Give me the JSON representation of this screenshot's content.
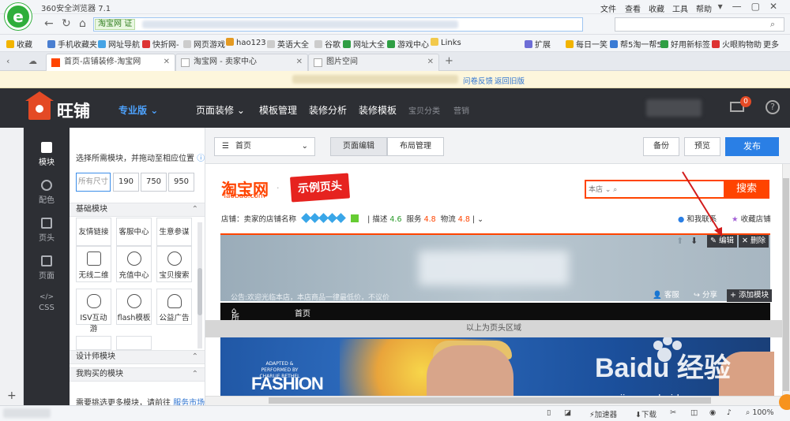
{
  "browser": {
    "title": "360安全浏览器 7.1",
    "menu": [
      "文件",
      "查看",
      "收藏",
      "工具",
      "帮助"
    ],
    "address_cert": "证",
    "bookmarks": [
      "收藏",
      "手机收藏夹",
      "网址导航",
      "快折网-",
      "网页游戏",
      "hao123",
      "英语大全",
      "谷歌",
      "网址大全",
      "游戏中心",
      "Links",
      "扩展",
      "每日一笑",
      "帮5淘一帮5",
      "好用新标签",
      "火眼购物助",
      "更多"
    ],
    "tabs": [
      {
        "label": "首页-店铺装修-淘宝网",
        "active": true
      },
      {
        "label": "淘宝网 - 卖家中心",
        "active": false
      },
      {
        "label": "图片空间",
        "active": false
      }
    ],
    "infobar": {
      "survey": "问卷反馈",
      "old_version": "返回旧版"
    },
    "status": {
      "accelerator": "加速器",
      "download": "下载",
      "zoom": "100%"
    }
  },
  "wangpu": {
    "brand": "旺铺",
    "edition": "专业版",
    "nav": [
      "页面装修",
      "模板管理",
      "装修分析",
      "装修模板",
      "宝贝分类",
      "营销"
    ],
    "mail_badge": "0",
    "help": "?"
  },
  "sidenav": [
    {
      "label": "模块",
      "active": true
    },
    {
      "label": "配色",
      "active": false
    },
    {
      "label": "页头",
      "active": false
    },
    {
      "label": "页面",
      "active": false
    },
    {
      "label": "CSS",
      "active": false
    }
  ],
  "sidenav_css_icon": "</>",
  "modules": {
    "hint": "选择所需模块，并拖动至相应位置",
    "sizes": [
      "所有尺寸",
      "190",
      "750",
      "950"
    ],
    "basic_header": "基础模块",
    "items": [
      "友情链接",
      "客服中心",
      "生意参谋",
      "无线二维",
      "充值中心",
      "宝贝搜索",
      "ISV互动游",
      "flash模板",
      "公益广告"
    ],
    "designer_header": "设计师模块",
    "purchased_header": "我购买的模块",
    "need_more": "需要挑选更多模块，请前往",
    "market_link": "服务市场"
  },
  "toolbar": {
    "page": "首页",
    "page_edit": "页面编辑",
    "layout": "布局管理",
    "backup": "备份",
    "preview": "预览",
    "publish": "发布"
  },
  "store": {
    "tb_logo": "淘宝网",
    "tb_sub": "Taobao.com",
    "sample_header": "示例页头",
    "search_scope": "本店",
    "search_btn": "搜索",
    "shop_name_label": "店铺：卖家的店铺名称",
    "desc_label": "描述",
    "desc_val": "4.6",
    "service_label": "服务",
    "service_val": "4.8",
    "logistics_label": "物流",
    "logistics_val": "4.8",
    "contact": "和我联系",
    "favorite": "收藏店铺",
    "notice": "公告:欢迎光临本店，本店商品一律最低价，不议价",
    "kefu": "客服",
    "share": "分享",
    "edit": "编辑",
    "delete": "删除",
    "add_module": "添加模块",
    "cat_all": "所有分类",
    "cat_home": "首页",
    "above_header": "以上为页头区域",
    "poster_adapted": "ADAPTED & PERFORMED BY CHARLIE BETHEL",
    "poster_fashion": "FASHION"
  },
  "watermark": {
    "brand": "Baidu 经验",
    "url": "jingyan.baidu.com"
  },
  "colors": {
    "accent": "#2a7fe5",
    "taobao": "#ff4400",
    "dark": "#2d2f34"
  }
}
